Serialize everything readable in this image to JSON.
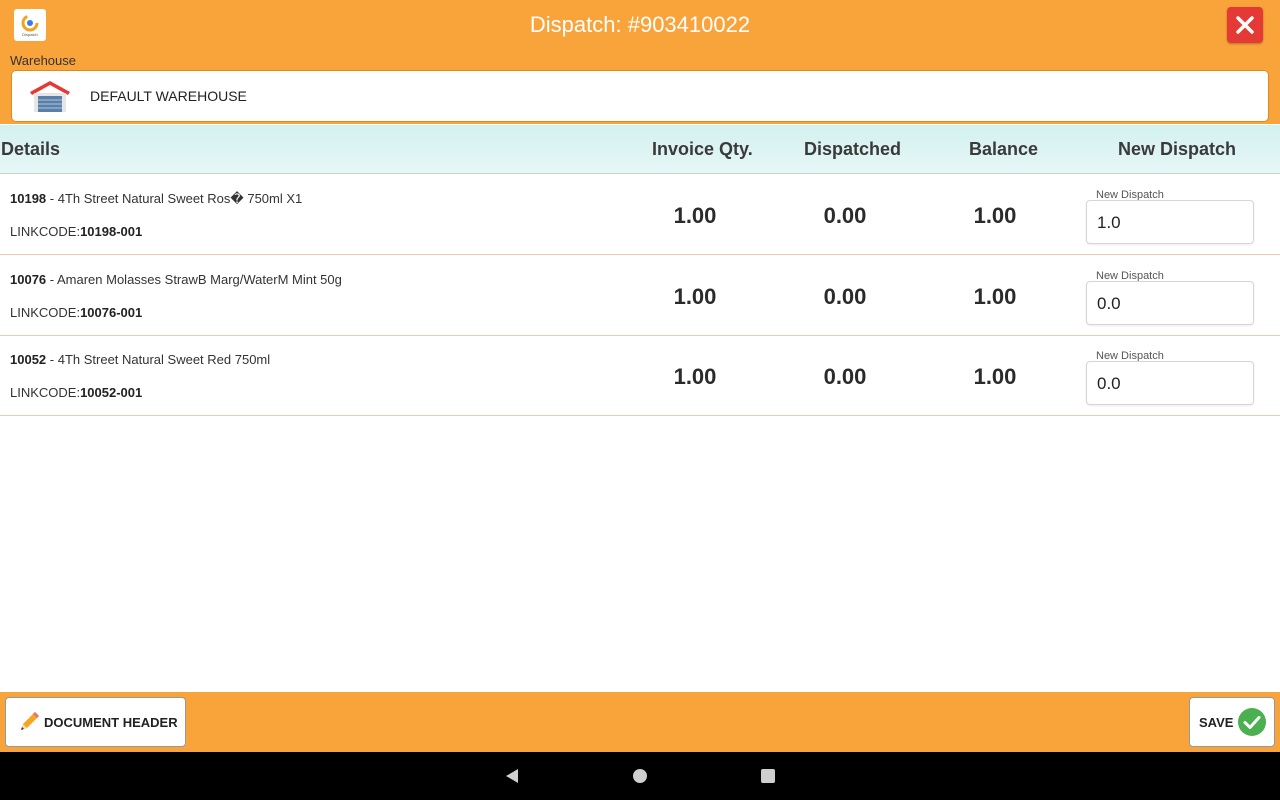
{
  "header": {
    "title": "Dispatch: #903410022",
    "logo_text": "Dispatch",
    "close_icon": "close-icon"
  },
  "warehouse": {
    "label": "Warehouse",
    "name": "DEFAULT WAREHOUSE",
    "icon": "warehouse-icon"
  },
  "table": {
    "columns": {
      "details": "Details",
      "invoice_qty": "Invoice Qty.",
      "dispatched": "Dispatched",
      "balance": "Balance",
      "new_dispatch": "New Dispatch"
    },
    "rows": [
      {
        "code": "10198",
        "description": " - 4Th Street Natural Sweet Ros� 750ml X1",
        "linkcode_label": "LINKCODE:",
        "linkcode": "10198-001",
        "invoice_qty": "1.00",
        "dispatched": "0.00",
        "balance": "1.00",
        "new_dispatch_label": "New Dispatch",
        "new_dispatch_value": "1.0"
      },
      {
        "code": "10076",
        "description": " - Amaren Molasses StrawB Marg/WaterM Mint 50g",
        "linkcode_label": "LINKCODE:",
        "linkcode": "10076-001",
        "invoice_qty": "1.00",
        "dispatched": "0.00",
        "balance": "1.00",
        "new_dispatch_label": "New Dispatch",
        "new_dispatch_value": "0.0"
      },
      {
        "code": "10052",
        "description": " - 4Th Street Natural Sweet Red 750ml",
        "linkcode_label": "LINKCODE:",
        "linkcode": "10052-001",
        "invoice_qty": "1.00",
        "dispatched": "0.00",
        "balance": "1.00",
        "new_dispatch_label": "New Dispatch",
        "new_dispatch_value": "0.0"
      }
    ]
  },
  "footer": {
    "document_header_label": "DOCUMENT HEADER",
    "save_label": "SAVE"
  },
  "colors": {
    "brand_orange": "#F9A43A",
    "close_red": "#E53935",
    "header_teal": "#D3F1F0",
    "save_green": "#4CAF50"
  }
}
